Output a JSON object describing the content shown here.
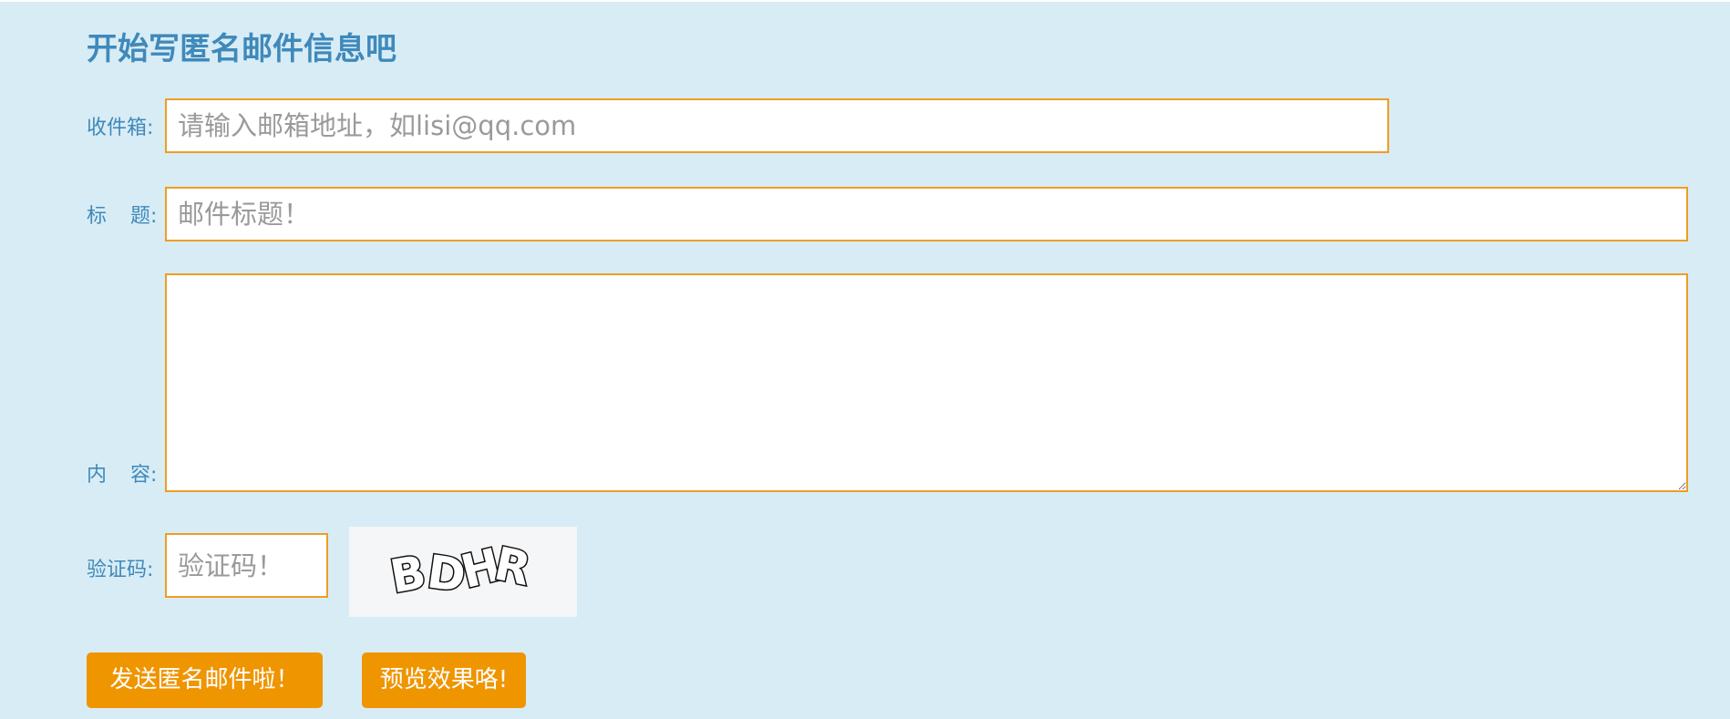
{
  "form": {
    "title": "开始写匿名邮件信息吧",
    "recipient": {
      "label": "收件箱:",
      "placeholder": "请输入邮箱地址，如lisi@qq.com",
      "value": ""
    },
    "subject": {
      "label_part1": "标",
      "label_part2": "题:",
      "placeholder": "邮件标题！",
      "value": ""
    },
    "content": {
      "label_part1": "内",
      "label_part2": "容:",
      "value": ""
    },
    "captcha": {
      "label": "验证码:",
      "placeholder": "验证码！",
      "value": "",
      "image_text": "BDHR"
    },
    "buttons": {
      "send": "发送匿名邮件啦！",
      "preview": "预览效果咯!"
    }
  },
  "colors": {
    "background": "#d8ecf5",
    "accent": "#ef9d22",
    "button": "#ef9500",
    "label": "#3f89bb"
  }
}
